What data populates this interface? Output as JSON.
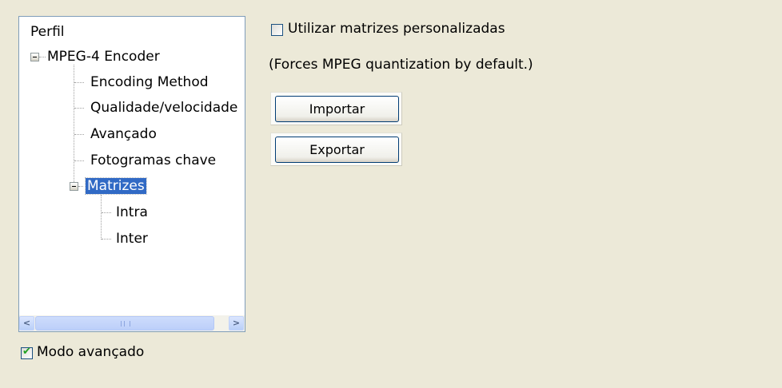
{
  "tree": {
    "root_label": "Perfil",
    "encoder_label": "MPEG-4 Encoder",
    "children": [
      "Encoding Method",
      "Qualidade/velocidade",
      "Avançado",
      "Fotogramas chave"
    ],
    "matrices_label": "Matrizes",
    "matrices_children": [
      "Intra",
      "Inter"
    ],
    "selected": "Matrizes"
  },
  "scrollbar": {
    "left_arrow": "<",
    "right_arrow": ">"
  },
  "advanced_mode": {
    "label": "Modo avançado",
    "checked": true
  },
  "custom_matrices": {
    "label": "Utilizar matrizes personalizadas",
    "checked": false,
    "note": "(Forces MPEG quantization by default.)"
  },
  "buttons": {
    "import_label": "Importar",
    "export_label": "Exportar"
  },
  "colors": {
    "dialog_background": "#ece9d8",
    "selection": "#316ac5",
    "check_green": "#21a121"
  }
}
